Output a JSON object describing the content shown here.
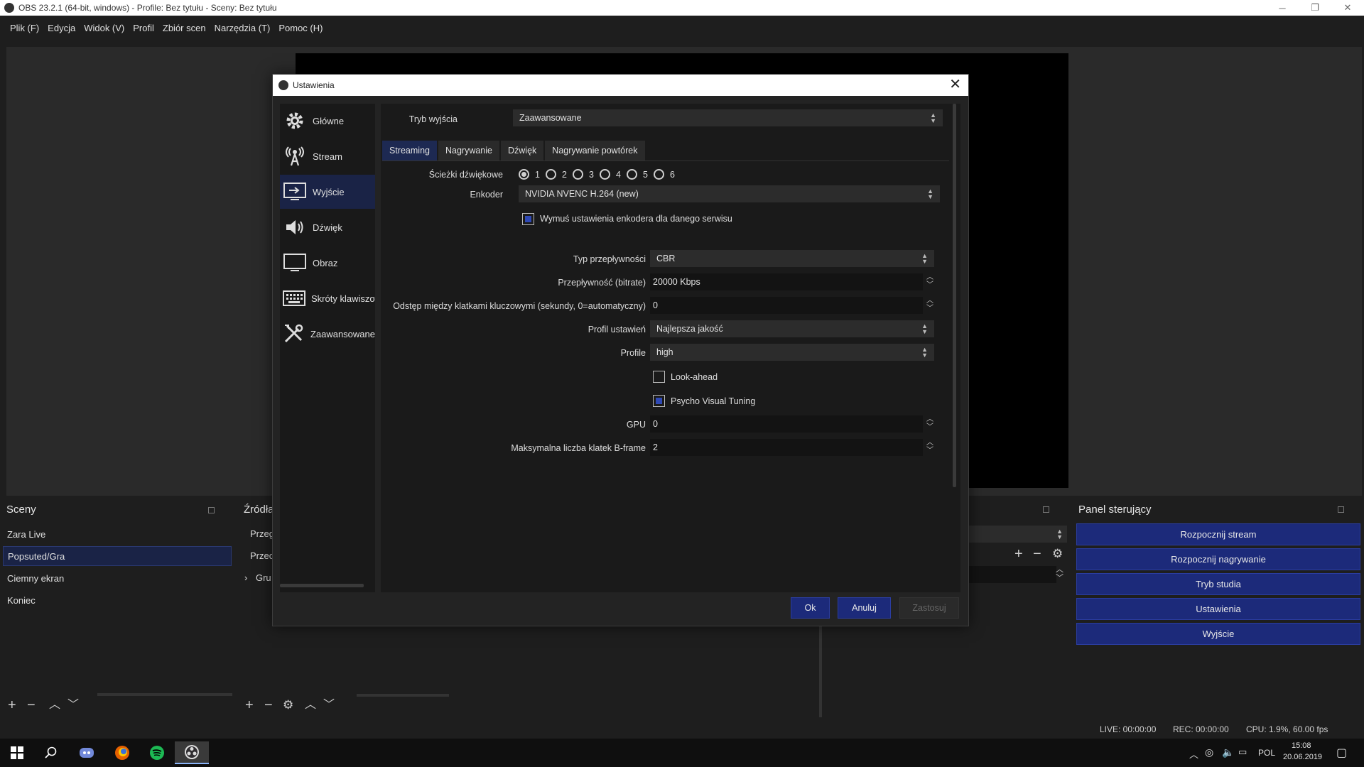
{
  "window": {
    "title": "OBS 23.2.1 (64-bit, windows) - Profile: Bez tytułu - Sceny: Bez tytułu",
    "controls": [
      "─",
      "❐",
      "✕"
    ]
  },
  "menu": [
    "Plik (F)",
    "Edycja",
    "Widok (V)",
    "Profil",
    "Zbiór scen",
    "Narzędzia (T)",
    "Pomoc (H)"
  ],
  "scenes": {
    "title": "Sceny",
    "items": [
      "Zara Live",
      "Popsuted/Gra",
      "Ciemny ekran",
      "Koniec"
    ],
    "selected_index": 1
  },
  "sources": {
    "title": "Źródła",
    "items": [
      "Przeg",
      "Przec",
      "Gru"
    ]
  },
  "control_panel": {
    "title": "Panel sterujący",
    "buttons": [
      "Rozpocznij stream",
      "Rozpocznij nagrywanie",
      "Tryb studia",
      "Ustawienia",
      "Wyjście"
    ]
  },
  "status": {
    "live": "LIVE: 00:00:00",
    "rec": "REC: 00:00:00",
    "cpu": "CPU: 1.9%, 60.00 fps"
  },
  "taskbar": {
    "apps": [
      "windows-start",
      "search",
      "discord",
      "firefox",
      "spotify",
      "obs"
    ],
    "active": "obs",
    "lang": "POL",
    "time": "15:08",
    "date": "20.06.2019"
  },
  "settings": {
    "title": "Ustawienia",
    "sidebar": [
      "Główne",
      "Stream",
      "Wyjście",
      "Dźwięk",
      "Obraz",
      "Skróty klawiszowe",
      "Zaawansowane"
    ],
    "sidebar_selected": 2,
    "output_mode_label": "Tryb wyjścia",
    "output_mode_value": "Zaawansowane",
    "tabs": [
      "Streaming",
      "Nagrywanie",
      "Dźwięk",
      "Nagrywanie powtórek"
    ],
    "tab_selected": 0,
    "audio_tracks_label": "Ścieżki dźwiękowe",
    "audio_tracks": [
      "1",
      "2",
      "3",
      "4",
      "5",
      "6"
    ],
    "audio_track_selected": 0,
    "encoder_label": "Enkoder",
    "encoder_value": "NVIDIA NVENC H.264 (new)",
    "enforce_label": "Wymuś ustawienia enkodera dla danego serwisu",
    "enforce_checked": true,
    "rate_control_label": "Typ przepływności",
    "rate_control_value": "CBR",
    "bitrate_label": "Przepływność (bitrate)",
    "bitrate_value": "20000 Kbps",
    "keyframe_label": "Odstęp między klatkami kluczowymi (sekundy, 0=automatyczny)",
    "keyframe_value": "0",
    "preset_label": "Profil ustawień",
    "preset_value": "Najlepsza jakość",
    "profile_label": "Profile",
    "profile_value": "high",
    "lookahead_label": "Look-ahead",
    "lookahead_checked": false,
    "psycho_label": "Psycho Visual Tuning",
    "psycho_checked": true,
    "gpu_label": "GPU",
    "gpu_value": "0",
    "bframes_label": "Maksymalna liczba klatek B-frame",
    "bframes_value": "2",
    "buttons": {
      "ok": "Ok",
      "cancel": "Anuluj",
      "apply": "Zastosuj"
    }
  }
}
